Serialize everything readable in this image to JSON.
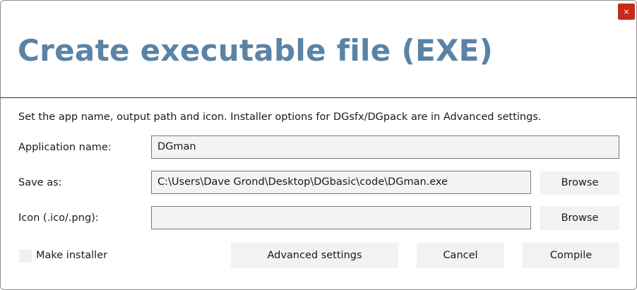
{
  "window": {
    "title": "Create executable file (EXE)",
    "close_glyph": "×",
    "close_color": "#c42b1c",
    "title_color": "#5a83a6"
  },
  "description": "Set the app name, output path and icon. Installer options for DGsfx/DGpack are in Advanced settings.",
  "form": {
    "app_name": {
      "label": "Application name:",
      "value": "DGman"
    },
    "save_as": {
      "label": "Save as:",
      "value": "C:\\Users\\Dave Grond\\Desktop\\DGbasic\\code\\DGman.exe",
      "browse_label": "Browse"
    },
    "icon": {
      "label": "Icon (.ico/.png):",
      "value": "",
      "browse_label": "Browse"
    }
  },
  "footer": {
    "make_installer_label": "Make installer",
    "make_installer_checked": false,
    "advanced_label": "Advanced settings",
    "cancel_label": "Cancel",
    "compile_label": "Compile"
  }
}
